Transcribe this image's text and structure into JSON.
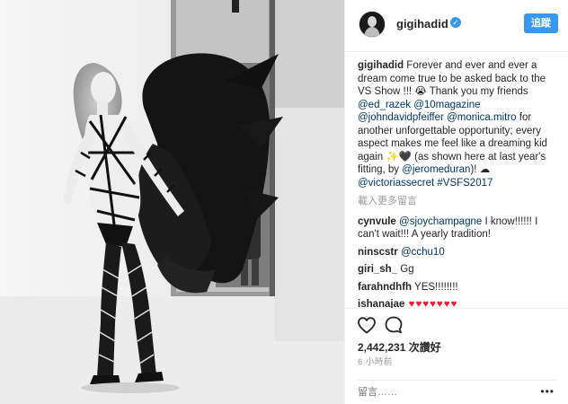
{
  "post": {
    "username": "gigihadid",
    "follow_label": "追蹤",
    "caption": {
      "user": "gigihadid",
      "t1": " Forever and ever and ever a dream come true to be asked back to the VS Show !!! ",
      "emoji1": "😭",
      "t2": " Thank you my friends ",
      "m1": "@ed_razek",
      "t3": " ",
      "m2": "@10magazine",
      "t4": " ",
      "m3": "@johndavidpfeiffer",
      "t5": " ",
      "m4": "@monica.mitro",
      "t6": " for another unforgettable opportunity; every aspect makes me feel like a dreaming kid again ",
      "emoji2": "✨🖤",
      "t7": " (as shown here at last year's fitting, by ",
      "m5": "@jeromeduran",
      "t8": ")! ",
      "emoji3": "☁",
      "t9": " ",
      "m6": "@victoriassecret",
      "t10": " ",
      "m7": "#VSFS2017"
    },
    "load_more": "載入更多留言",
    "comments": [
      {
        "user": "cynvule",
        "mention": "@sjoychampagne",
        "text": " I know!!!!!! I can't wait!!! A yearly tradition!"
      },
      {
        "user": "ninscstr",
        "mention": "@cchu10",
        "text": ""
      },
      {
        "user": "giri_sh_",
        "mention": "",
        "text": " Gg"
      },
      {
        "user": "farahndhfh",
        "mention": "",
        "text": " YES!!!!!!!!"
      },
      {
        "user": "ishanajae",
        "mention": "",
        "text": " ♥♥♥♥♥♥♥"
      },
      {
        "user": "",
        "mention": "",
        "text": "…"
      }
    ],
    "likes": "2,442,231 次讚好",
    "time_ago": "6 小時前",
    "comment_placeholder": "留言……",
    "more_label": "•••"
  },
  "colors": {
    "accent": "#3897f0",
    "mention": "#003569",
    "heart": "#ed1c2e",
    "muted": "#999999"
  },
  "icons": [
    "verified-badge-icon",
    "heart-icon",
    "comment-icon",
    "more-options-icon"
  ]
}
